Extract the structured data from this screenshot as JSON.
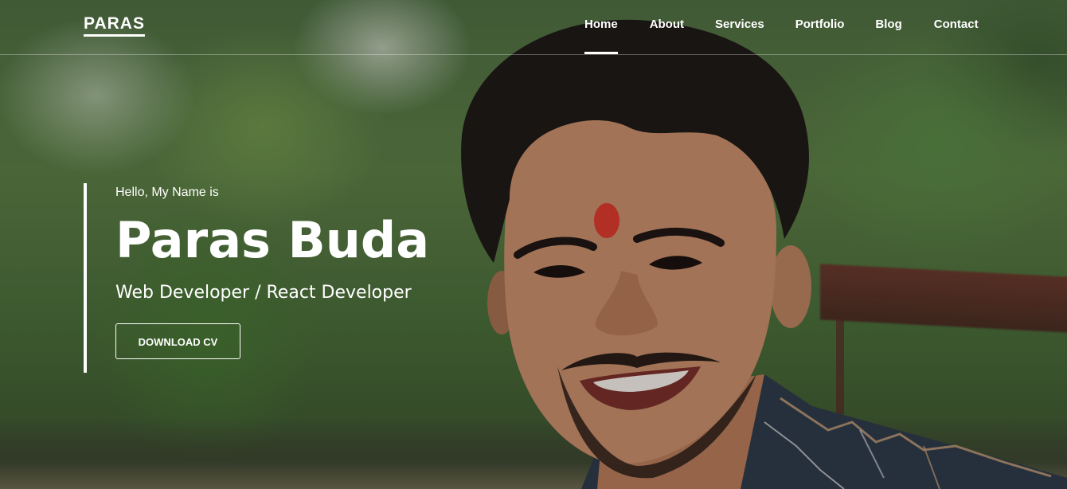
{
  "header": {
    "logo": "PARAS",
    "nav": [
      {
        "label": "Home",
        "active": true
      },
      {
        "label": "About",
        "active": false
      },
      {
        "label": "Services",
        "active": false
      },
      {
        "label": "Portfolio",
        "active": false
      },
      {
        "label": "Blog",
        "active": false
      },
      {
        "label": "Contact",
        "active": false
      }
    ]
  },
  "hero": {
    "greeting": "Hello, My Name is",
    "name": "Paras Buda",
    "role": "Web Developer / React Developer",
    "cta_label": "DOWNLOAD CV",
    "background_image": "smiling-man-portrait-outdoors"
  },
  "colors": {
    "text": "#ffffff",
    "accent_line": "#ffffff"
  }
}
